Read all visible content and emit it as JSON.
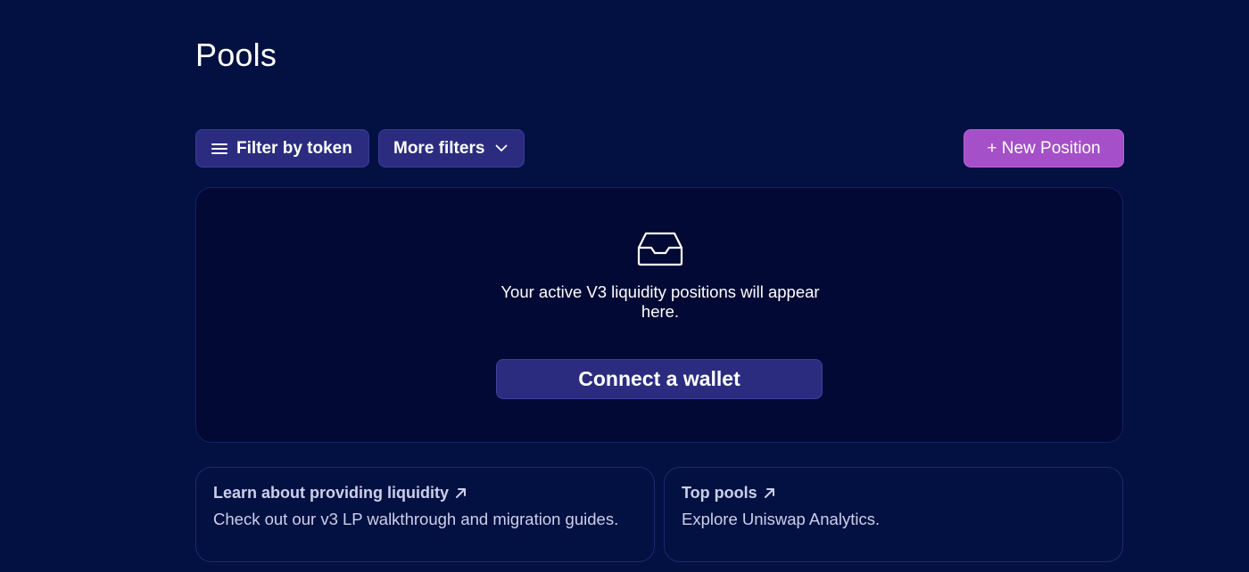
{
  "page": {
    "title": "Pools"
  },
  "toolbar": {
    "filter_by_token_label": "Filter by token",
    "more_filters_label": "More filters",
    "new_position_label": "+ New Position"
  },
  "empty_state": {
    "message": "Your active V3 liquidity positions will appear here.",
    "connect_wallet_label": "Connect a wallet"
  },
  "cards": [
    {
      "title": "Learn about providing liquidity",
      "description": "Check out our v3 LP walkthrough and migration guides."
    },
    {
      "title": "Top pools",
      "description": "Explore Uniswap Analytics."
    }
  ],
  "icons": {
    "filter": "menu-icon",
    "more_filters": "chevron-down-icon",
    "empty": "inbox-icon",
    "external_link": "arrow-up-right-icon"
  },
  "colors": {
    "background": "#031042",
    "panel": "#020935",
    "button": "#2b2c80",
    "accent": "#a54fc9",
    "muted_text": "#cbd0ea"
  }
}
